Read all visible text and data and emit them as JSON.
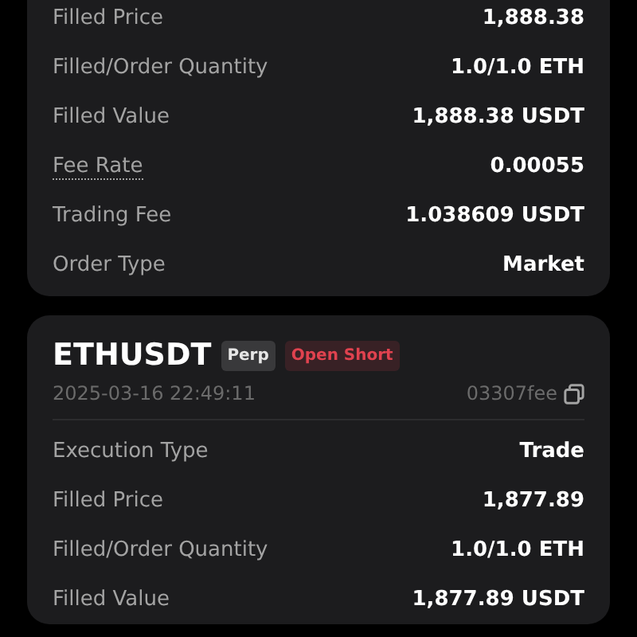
{
  "orders": [
    {
      "rows": [
        {
          "label": "Filled Price",
          "value": "1,888.38",
          "hint": false
        },
        {
          "label": "Filled/Order Quantity",
          "value": "1.0/1.0 ETH",
          "hint": false
        },
        {
          "label": "Filled Value",
          "value": "1,888.38 USDT",
          "hint": false
        },
        {
          "label": "Fee Rate",
          "value": "0.00055",
          "hint": true
        },
        {
          "label": "Trading Fee",
          "value": "1.038609 USDT",
          "hint": false
        },
        {
          "label": "Order Type",
          "value": "Market",
          "hint": false
        }
      ]
    },
    {
      "symbol": "ETHUSDT",
      "tags": [
        {
          "text": "Perp",
          "color": "#e6e6e6"
        },
        {
          "text": "Open Short",
          "color": "#e0424f"
        }
      ],
      "time": "2025-03-16 22:49:11",
      "order_id": "03307fee",
      "rows": [
        {
          "label": "Execution Type",
          "value": "Trade",
          "hint": false
        },
        {
          "label": "Filled Price",
          "value": "1,877.89",
          "hint": false
        },
        {
          "label": "Filled/Order Quantity",
          "value": "1.0/1.0 ETH",
          "hint": false
        },
        {
          "label": "Filled Value",
          "value": "1,877.89 USDT",
          "hint": false
        }
      ]
    }
  ]
}
